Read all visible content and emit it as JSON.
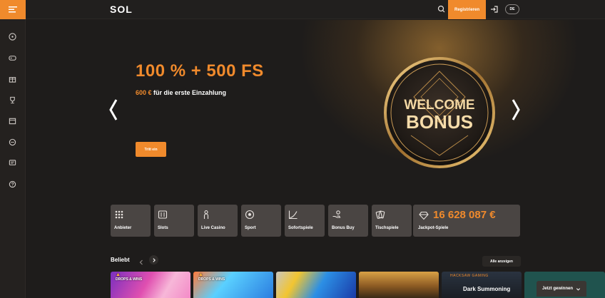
{
  "header": {
    "logo_text": "SOL",
    "register_label": "Registrieren",
    "language": "DE"
  },
  "sidebar": {
    "items": [
      {
        "icon": "dice-icon"
      },
      {
        "icon": "gamepad-icon"
      },
      {
        "icon": "gift-icon"
      },
      {
        "icon": "trophy-icon"
      },
      {
        "icon": "calendar-icon"
      },
      {
        "icon": "coin-swap-icon"
      },
      {
        "icon": "chat-icon"
      },
      {
        "icon": "help-icon"
      }
    ]
  },
  "hero": {
    "title": "100 % + 500 FS",
    "subtitle_amount": "600 €",
    "subtitle_rest": " für die erste Einzahlung",
    "cta_label": "Tritt ein",
    "coin_line1": "WELCOME",
    "coin_line2": "BONUS"
  },
  "categories": [
    {
      "label": "Anbieter",
      "icon": "grid-dots-icon"
    },
    {
      "label": "Slots",
      "icon": "slot-machine-icon"
    },
    {
      "label": "Live Casino",
      "icon": "person-icon"
    },
    {
      "label": "Sport",
      "icon": "soccer-ball-icon"
    },
    {
      "label": "Sofortspiele",
      "icon": "chart-curve-icon"
    },
    {
      "label": "Bonus Buy",
      "icon": "hand-coins-icon"
    },
    {
      "label": "Tischspiele",
      "icon": "cards-icon"
    }
  ],
  "jackpot": {
    "amount": "16 628 087 €",
    "label": "Jackpot-Spiele"
  },
  "popular": {
    "title": "Beliebt",
    "show_all": "Alle anzeigen",
    "games": [
      {
        "badge": "DROPS & WINS"
      },
      {
        "badge": "DROPS & WINS"
      },
      {
        "badge": ""
      },
      {
        "badge": ""
      },
      {
        "provider": "HACKSAW GAMING",
        "name": "Dark Summoning"
      },
      {
        "badge": ""
      }
    ]
  },
  "play_now": "Jetzt gewinnen"
}
